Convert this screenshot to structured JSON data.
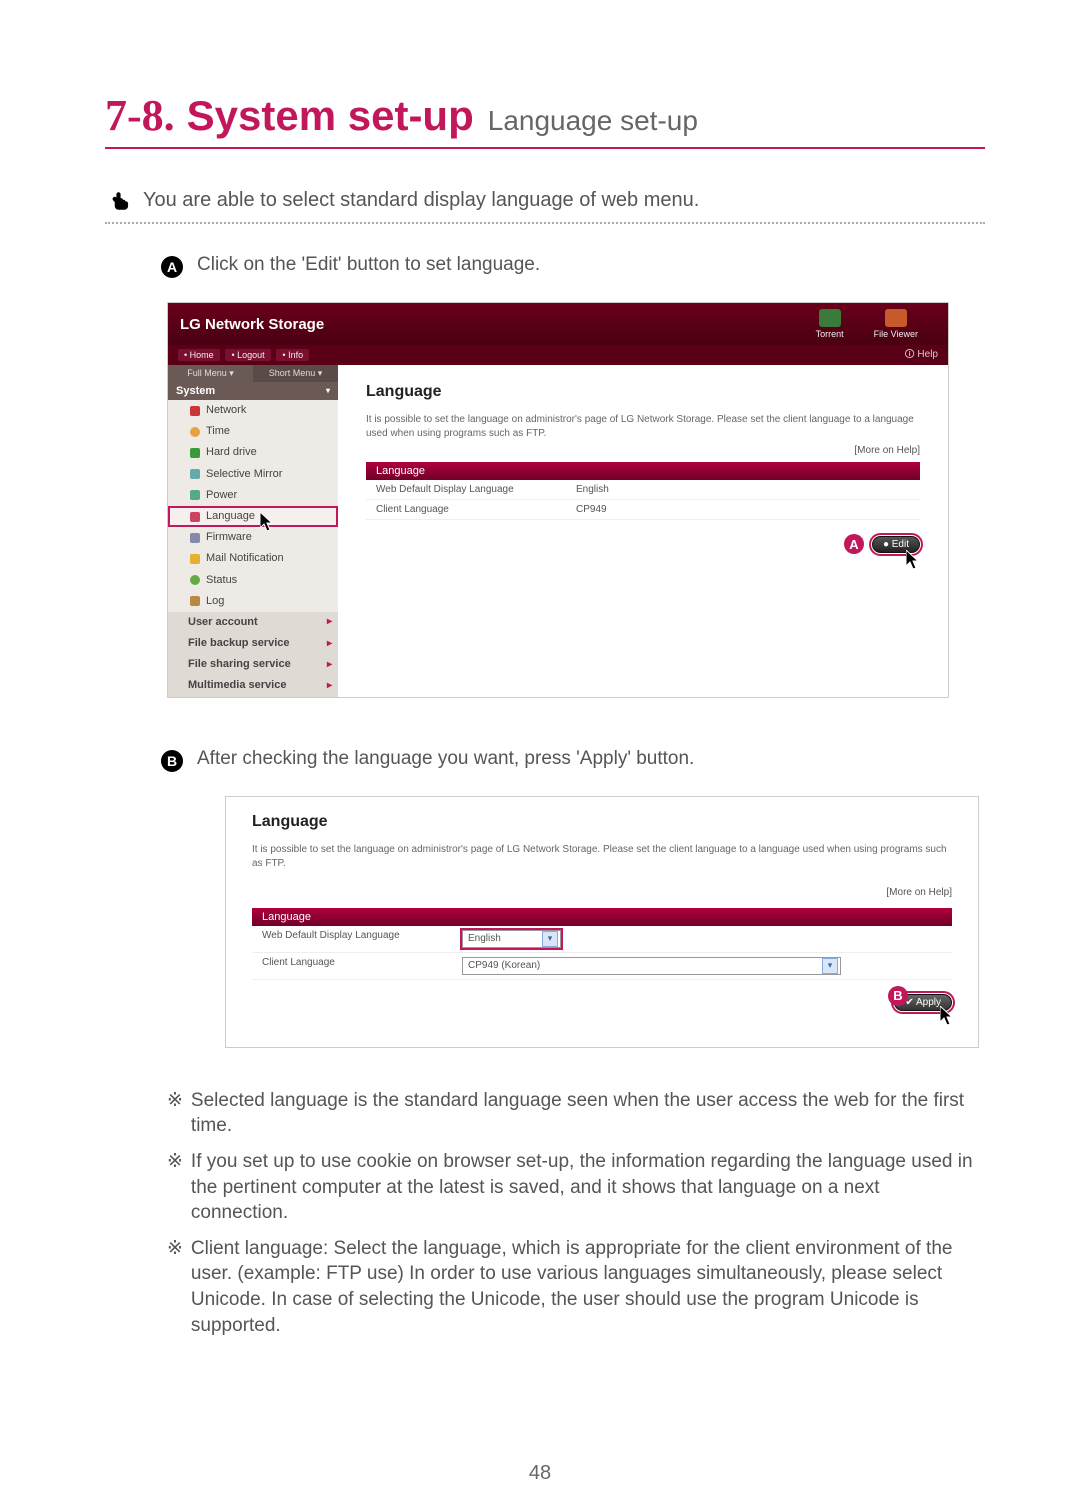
{
  "page": {
    "section_number": "7-8.",
    "title_main": "System set-up",
    "title_sub": "Language set-up",
    "intro": "You are able to select standard display language of web menu.",
    "page_number": "48"
  },
  "steps": {
    "a_label": "A",
    "a_text": "Click on the 'Edit' button to set language.",
    "b_label": "B",
    "b_text": "After checking the language you want, press 'Apply' button."
  },
  "shotA": {
    "header_title": "LG Network Storage",
    "icon_torrent": "Torrent",
    "icon_fileviewer": "File Viewer",
    "nav_home": "• Home",
    "nav_logout": "• Logout",
    "nav_info": "• Info",
    "help": "Help",
    "menu_full": "Full Menu ▾",
    "menu_short": "Short Menu ▾",
    "section_system": "System",
    "items": {
      "network": "Network",
      "time": "Time",
      "harddrive": "Hard drive",
      "selectivemirror": "Selective Mirror",
      "power": "Power",
      "language": "Language",
      "firmware": "Firmware",
      "mail": "Mail Notification",
      "status": "Status",
      "log": "Log"
    },
    "exp_user": "User account",
    "exp_backup": "File backup service",
    "exp_sharing": "File sharing service",
    "exp_multimedia": "Multimedia service",
    "content_title": "Language",
    "content_desc": "It is possible to set the language on administror's page of LG Network Storage. Please set the client language to a language used when using programs such as FTP.",
    "more_help": "[More on Help]",
    "table_head": "Language",
    "row1_label": "Web Default Display Language",
    "row1_value": "English",
    "row2_label": "Client Language",
    "row2_value": "CP949",
    "edit_btn": "● Edit",
    "callout": "A"
  },
  "shotB": {
    "content_title": "Language",
    "content_desc": "It is possible to set the language on administror's page of LG Network Storage. Please set the client language to a language used when using programs such as FTP.",
    "more_help": "[More on Help]",
    "table_head": "Language",
    "row1_label": "Web Default Display Language",
    "row1_value": "English",
    "row2_label": "Client Language",
    "row2_value": "CP949 (Korean)",
    "apply_btn": "✔ Apply",
    "callout": "B"
  },
  "notes": {
    "sym": "※",
    "n1": "Selected language is the standard language seen when the user access the web for the first time.",
    "n2": "If you set up to use cookie on browser set-up, the information regarding the language used in the pertinent computer at the latest is saved, and it shows that language on a next connection.",
    "n3": "Client language: Select the language, which is appropriate for the client environment of the user. (example: FTP use) In order to use various languages simultaneously, please select Unicode. In case of selecting the Unicode, the user should use the program Unicode is supported."
  }
}
